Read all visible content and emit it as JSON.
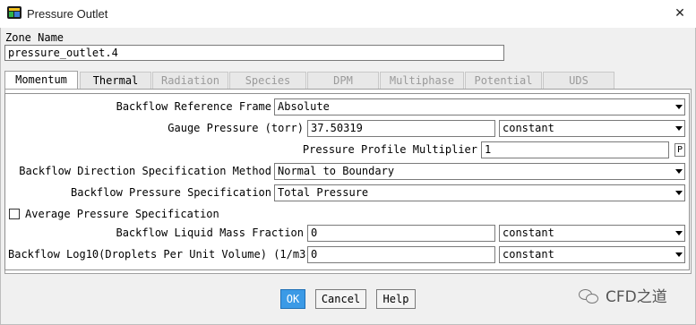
{
  "window": {
    "title": "Pressure Outlet",
    "close_glyph": "✕"
  },
  "zone": {
    "label": "Zone Name",
    "value": "pressure_outlet.4"
  },
  "tabs": [
    {
      "label": "Momentum",
      "state": "active"
    },
    {
      "label": "Thermal",
      "state": "enabled"
    },
    {
      "label": "Radiation",
      "state": "disabled"
    },
    {
      "label": "Species",
      "state": "disabled"
    },
    {
      "label": "DPM",
      "state": "disabled"
    },
    {
      "label": "Multiphase",
      "state": "disabled"
    },
    {
      "label": "Potential",
      "state": "disabled"
    },
    {
      "label": "UDS",
      "state": "disabled"
    }
  ],
  "momentum": {
    "backflow_ref_frame": {
      "label": "Backflow Reference Frame",
      "value": "Absolute"
    },
    "gauge_pressure": {
      "label": "Gauge Pressure (torr)",
      "value": "37.50319",
      "method": "constant"
    },
    "profile_multiplier": {
      "label": "Pressure Profile Multiplier",
      "value": "1",
      "param_button": "P"
    },
    "backflow_direction": {
      "label": "Backflow Direction Specification Method",
      "value": "Normal to Boundary"
    },
    "backflow_pressure_spec": {
      "label": "Backflow Pressure Specification",
      "value": "Total Pressure"
    },
    "average_pressure": {
      "label": "Average Pressure Specification",
      "checked": false
    },
    "liquid_mass_fraction": {
      "label": "Backflow Liquid Mass Fraction",
      "value": "0",
      "method": "constant"
    },
    "log10_droplets": {
      "label": "Backflow Log10(Droplets Per Unit Volume) (1/m3)",
      "value": "0",
      "method": "constant"
    }
  },
  "buttons": {
    "ok": "OK",
    "cancel": "Cancel",
    "help": "Help"
  },
  "watermark": {
    "text": "CFD之道",
    "icon": "wechat-icon"
  },
  "colors": {
    "accent": "#3b9ae6",
    "disabled_text": "#9a9a9a"
  }
}
